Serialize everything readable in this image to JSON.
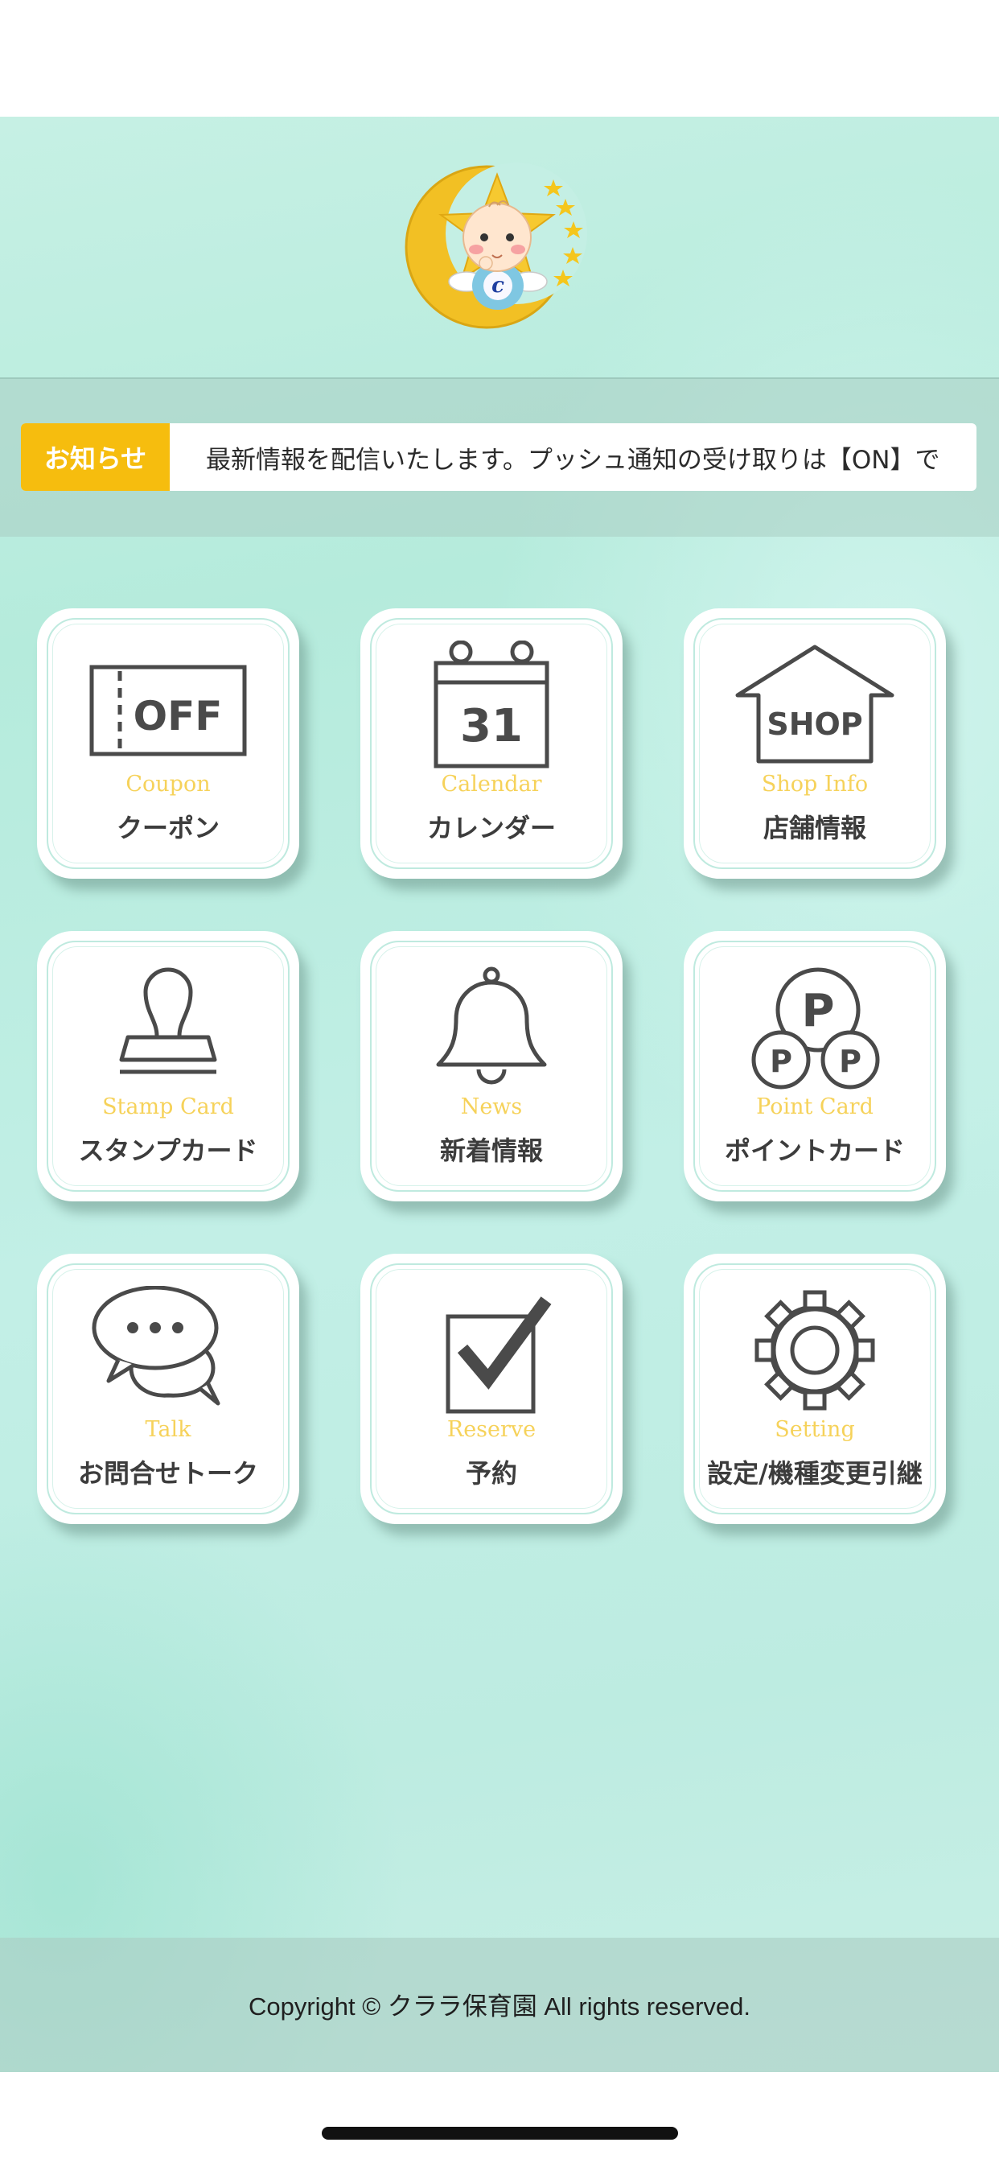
{
  "news": {
    "label": "お知らせ",
    "message": "最新情報を配信いたします。プッシュ通知の受け取りは【ON】で"
  },
  "tiles": [
    {
      "en": "Coupon",
      "jp": "クーポン",
      "icon": "coupon-off-icon",
      "icon_text": "OFF"
    },
    {
      "en": "Calendar",
      "jp": "カレンダー",
      "icon": "calendar-icon",
      "icon_text": "31"
    },
    {
      "en": "Shop Info",
      "jp": "店舗情報",
      "icon": "shop-icon",
      "icon_text": "SHOP"
    },
    {
      "en": "Stamp Card",
      "jp": "スタンプカード",
      "icon": "stamp-icon"
    },
    {
      "en": "News",
      "jp": "新着情報",
      "icon": "bell-icon"
    },
    {
      "en": "Point Card",
      "jp": "ポイントカード",
      "icon": "point-coins-icon",
      "icon_text": "P"
    },
    {
      "en": "Talk",
      "jp": "お問合せトーク",
      "icon": "chat-bubbles-icon"
    },
    {
      "en": "Reserve",
      "jp": "予約",
      "icon": "checkbox-icon"
    },
    {
      "en": "Setting",
      "jp": "設定/機種変更引継",
      "icon": "gear-icon"
    }
  ],
  "logo": {
    "letter": "c",
    "icon": "baby-moon-logo"
  },
  "footer": {
    "copyright": "Copyright © クララ保育園 All rights reserved."
  },
  "colors": {
    "accent": "#f6bd0e",
    "tile_en_text": "#f6d25a",
    "icon_stroke": "#4a4a4a"
  }
}
